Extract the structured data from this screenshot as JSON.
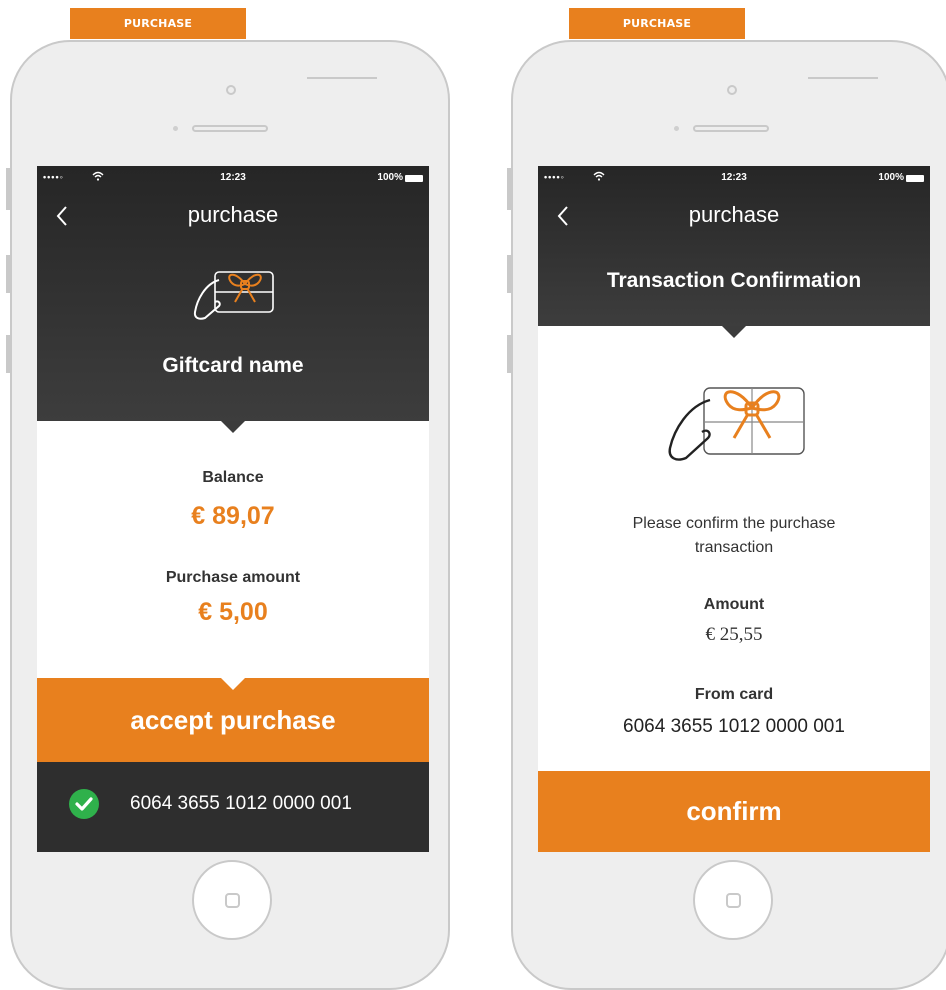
{
  "colors": {
    "accent": "#e8801e",
    "dark": "#2e2e2e",
    "success": "#2fb14b"
  },
  "left_screen": {
    "tab_label": "PURCHASE",
    "status": {
      "dots": "••••◦",
      "time": "12:23",
      "battery": "100%"
    },
    "nav": {
      "back_icon": "chevron-left-icon",
      "title": "purchase"
    },
    "giftcard_icon": "giftcard-hand-icon",
    "giftcard_name": "Giftcard name",
    "balance_label": "Balance",
    "balance_value": "€ 89,07",
    "purchase_amount_label": "Purchase amount",
    "purchase_amount_value": "€ 5,00",
    "accept_button": "accept purchase",
    "card": {
      "check_icon": "check-circle-icon",
      "number": "6064 3655 1012 0000 001"
    }
  },
  "right_screen": {
    "tab_label": "PURCHASE",
    "status": {
      "dots": "••••◦",
      "time": "12:23",
      "battery": "100%"
    },
    "nav": {
      "back_icon": "chevron-left-icon",
      "title": "purchase"
    },
    "heading": "Transaction Confirmation",
    "giftcard_icon": "giftcard-hand-icon",
    "message": "Please confirm the purchase transaction",
    "amount_label": "Amount",
    "amount_value": "€ 25,55",
    "from_card_label": "From card",
    "from_card_value": "6064 3655 1012 0000 001",
    "confirm_button": "confirm"
  }
}
